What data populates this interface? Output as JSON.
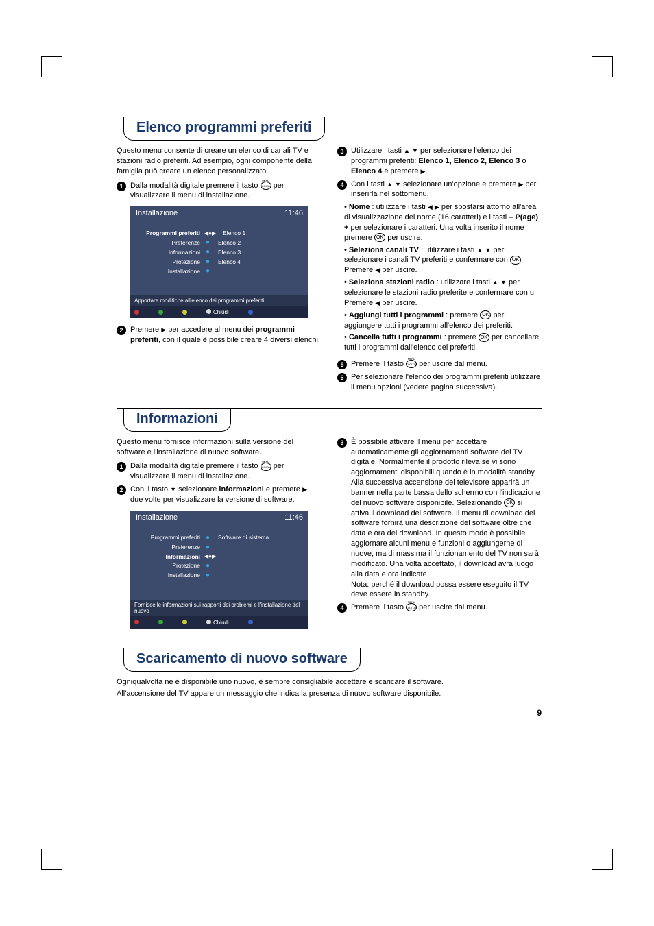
{
  "sections": {
    "favorites": {
      "title": "Elenco programmi preferiti",
      "intro": "Questo menu consente di creare un elenco di canali TV e stazioni radio preferiti. Ad esempio, ogni componente della famiglia può creare un elenco personalizzato.",
      "step1": "Dalla modalità digitale premere il tasto",
      "step1b": "per visualizzare il menu di installazione.",
      "step2a": "Premere",
      "step2b": "per accedere al menu dei",
      "step2c": "programmi preferiti",
      "step2d": ", con il quale è possibile creare 4 diversi elenchi.",
      "step3a": "Utilizzare i tasti",
      "step3b": "per selezionare l'elenco dei programmi preferiti:",
      "step3c": "Elenco 1, Elenco 2, Elenco 3",
      "step3d": "o",
      "step3e": "Elenco 4",
      "step3f": "e premere",
      "step4a": "Con i tasti",
      "step4b": "selezionare un'opzione e premere",
      "step4c": "per inserirla nel sottomenu.",
      "bullet_nome_label": "Nome",
      "bullet_nome": ": utilizzare i tasti",
      "bullet_nome2": "per spostarsi attorno all'area di visualizzazione del nome (16 caratteri) e i tasti",
      "bullet_nome2b": "– P(age) +",
      "bullet_nome3": "per selezionare i caratteri. Una volta inserito il nome premere",
      "bullet_nome4": "per uscire.",
      "bullet_canali_label": "Seleziona canali TV",
      "bullet_canali": ": utilizzare i tasti",
      "bullet_canali2": "per selezionare i canali TV preferiti e confermare con",
      "bullet_canali3": ". Premere",
      "bullet_canali4": "per uscire.",
      "bullet_radio_label": "Seleziona stazioni radio",
      "bullet_radio": ": utilizzare i tasti",
      "bullet_radio2": "per selezionare le stazioni radio preferite e confermare con u. Premere",
      "bullet_radio3": "per uscire.",
      "bullet_add_label": "Aggiungi tutti i programmi",
      "bullet_add": ": premere",
      "bullet_add2": "per aggiungere tutti i programmi all'elenco dei preferiti.",
      "bullet_del_label": "Cancella tutti i programmi",
      "bullet_del": ": premere",
      "bullet_del2": "per cancellare tutti i programmi dall'elenco dei preferiti.",
      "step5a": "Premere il tasto",
      "step5b": "per uscire dal menu.",
      "step6": "Per selezionare l'elenco dei programmi preferiti utilizzare il menu opzioni (vedere pagina successiva).",
      "screenshot": {
        "title": "Installazione",
        "time": "11:46",
        "menu": [
          "Programmi preferiti",
          "Preferenze",
          "Informazioni",
          "Protezione",
          "Installazione"
        ],
        "selected": 0,
        "right": [
          "Elenco 1",
          "Elenco 2",
          "Elenco 3",
          "Elenco 4"
        ],
        "footer1": "Apportare modifiche all'elenco dei programmi preferiti",
        "footer_close": "Chiudi"
      }
    },
    "info": {
      "title": "Informazioni",
      "intro": "Questo menu fornisce informazioni sulla versione del software e l'installazione di nuovo software.",
      "step1a": "Dalla modalità digitale premere il tasto",
      "step1b": "per visualizzare il menu di installazione.",
      "step2a": "Con il tasto",
      "step2b": "selezionare",
      "step2c": "informazioni",
      "step2d": "e premere",
      "step2e": "due volte per visualizzare la versione di software.",
      "step3": "È possibile attivare il menu per accettare automaticamente gli aggiornamenti software del TV digitale. Normalmente il prodotto rileva se vi sono aggiornamenti disponibili quando è in modalità standby. Alla successiva accensione del televisore apparirà un banner nella parte bassa dello schermo con l'indicazione del nuovo software disponibile. Selezionando",
      "step3b": "si attiva il download del software. Il menu di download del software fornirà una descrizione del software oltre che data e ora del download. In questo modo è possibile aggiornare alcuni menu e funzioni o aggiungerne di nuove, ma di massima il funzionamento del TV non sarà modificato. Una volta accettato, il download avrà luogo alla data e ora indicate.",
      "note": "Nota: perché il download possa essere eseguito il TV deve essere in standby.",
      "step4a": "Premere il tasto",
      "step4b": "per uscire dal menu.",
      "screenshot": {
        "title": "Installazione",
        "time": "11:46",
        "menu": [
          "Programmi preferiti",
          "Preferenze",
          "Informazioni",
          "Protezione",
          "Installazione"
        ],
        "selected": 2,
        "right": [
          "Software di sistema"
        ],
        "footer1": "Fornisce le informazioni sui rapporti dei problemi e l'installazione del nuovo",
        "footer_close": "Chiudi"
      }
    },
    "download": {
      "title": "Scaricamento di nuovo software",
      "body1": "Ogniqualvolta ne è disponibile uno nuovo, è sempre consigliabile accettare e scaricare il software.",
      "body2": "All'accensione del TV appare un messaggio che indica la presenza di nuovo software disponibile."
    }
  },
  "pagenum": "9",
  "icons": {
    "digital": "DIGITAL",
    "ok": "OK"
  }
}
